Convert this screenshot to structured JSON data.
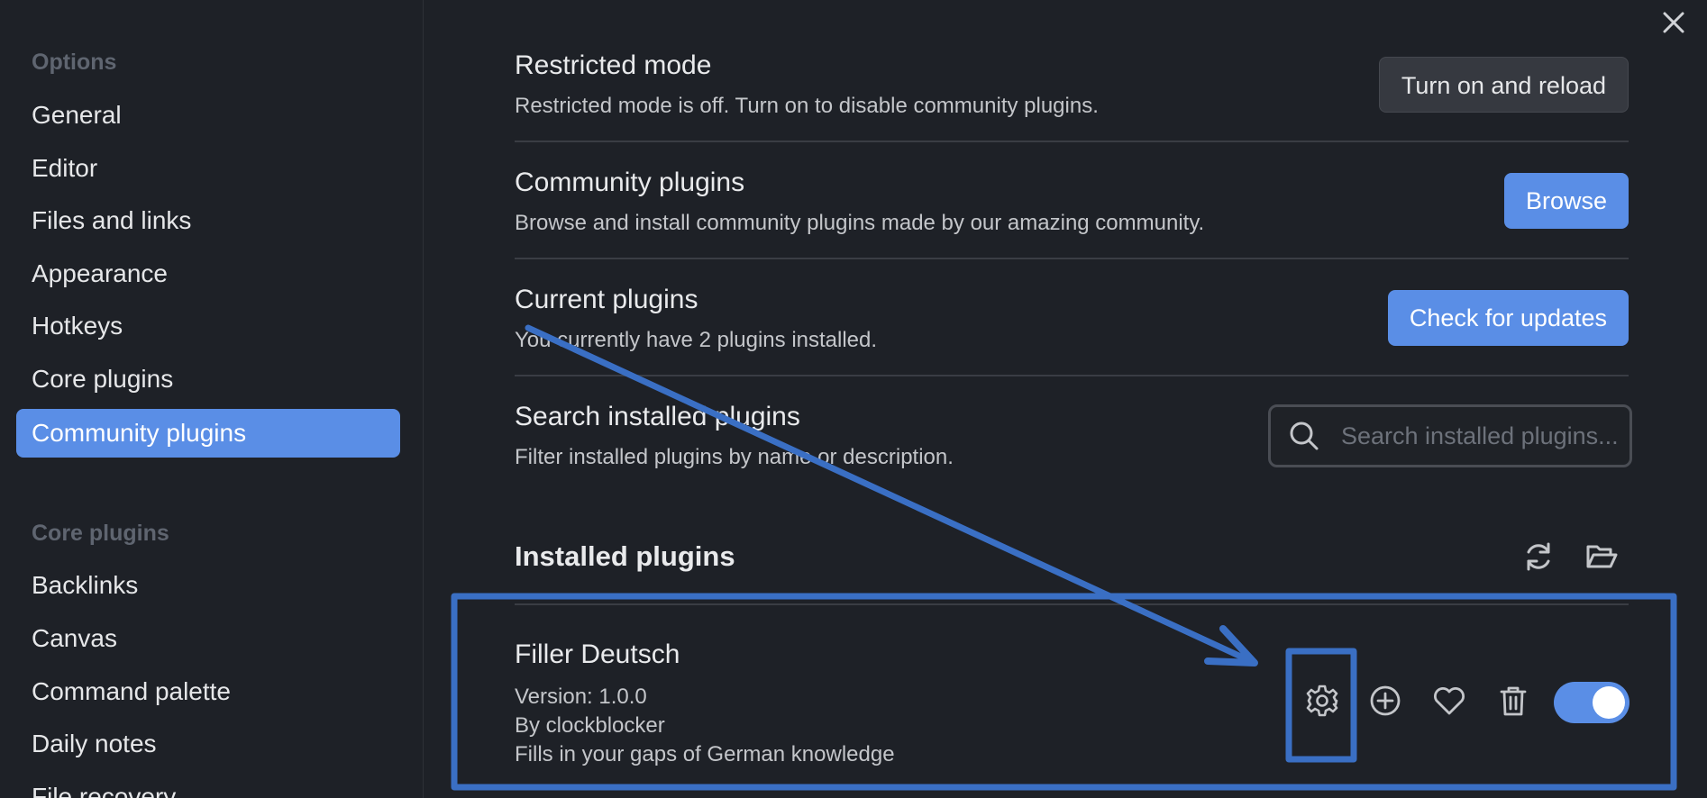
{
  "sidebar": {
    "options_heading": "Options",
    "options_items": [
      "General",
      "Editor",
      "Files and links",
      "Appearance",
      "Hotkeys",
      "Core plugins",
      "Community plugins"
    ],
    "active_item": "Community plugins",
    "core_heading": "Core plugins",
    "core_items": [
      "Backlinks",
      "Canvas",
      "Command palette",
      "Daily notes",
      "File recovery"
    ]
  },
  "settings": {
    "restricted": {
      "name": "Restricted mode",
      "desc": "Restricted mode is off. Turn on to disable community plugins.",
      "button": "Turn on and reload"
    },
    "community": {
      "name": "Community plugins",
      "desc": "Browse and install community plugins made by our amazing community.",
      "button": "Browse"
    },
    "current": {
      "name": "Current plugins",
      "desc": "You currently have 2 plugins installed.",
      "button": "Check for updates"
    },
    "search": {
      "name": "Search installed plugins",
      "desc": "Filter installed plugins by name or description.",
      "placeholder": "Search installed plugins..."
    }
  },
  "installed": {
    "title": "Installed plugins",
    "plugin": {
      "name": "Filler Deutsch",
      "version": "Version: 1.0.0",
      "author": "By clockblocker",
      "description": "Fills in your gaps of German knowledge",
      "enabled": true
    }
  },
  "icons": {
    "close": "close-icon",
    "search": "search-icon",
    "reload": "reload-icon",
    "folder": "folder-open-icon",
    "settings": "gear-icon",
    "hotkeys": "add-circle-icon",
    "favorite": "heart-icon",
    "uninstall": "trash-icon"
  },
  "colors": {
    "accent": "#5a8ee6",
    "annotation": "#3a6fc4",
    "background": "#1e2127"
  }
}
